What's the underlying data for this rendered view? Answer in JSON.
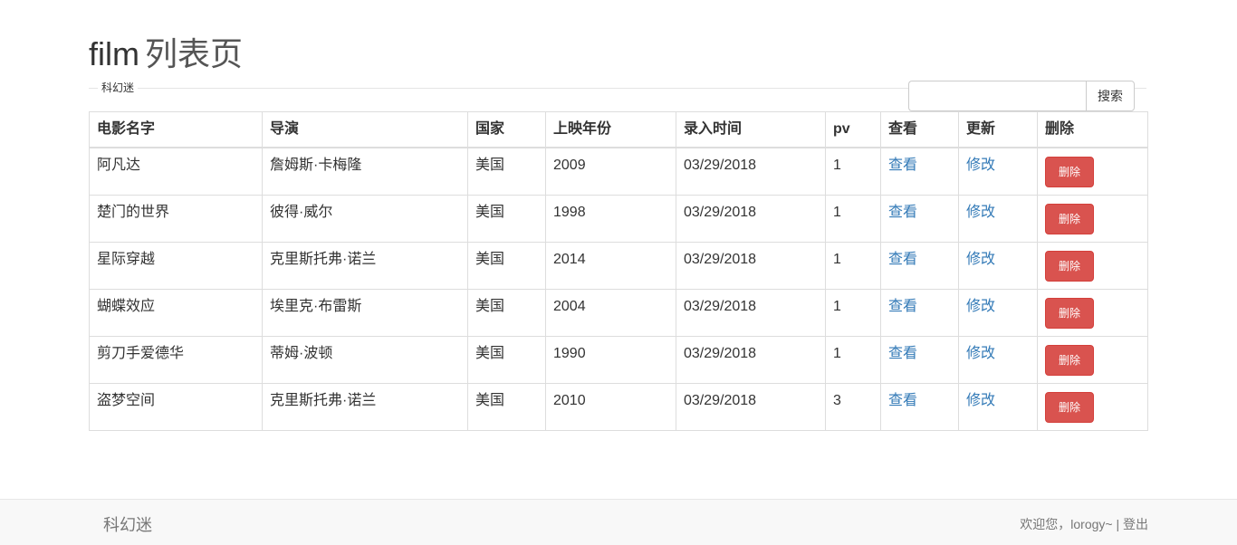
{
  "header": {
    "title_main": "film",
    "title_sub": "列表页"
  },
  "category": {
    "legend": "科幻迷"
  },
  "search": {
    "value": "",
    "placeholder": "",
    "button_label": "搜索"
  },
  "table": {
    "headers": [
      "电影名字",
      "导演",
      "国家",
      "上映年份",
      "录入时间",
      "pv",
      "查看",
      "更新",
      "删除"
    ],
    "rows": [
      {
        "name": "阿凡达",
        "director": "詹姆斯·卡梅隆",
        "country": "美国",
        "year": "2009",
        "created": "03/29/2018",
        "pv": "1",
        "view": "查看",
        "update": "修改",
        "delete": "删除"
      },
      {
        "name": "楚门的世界",
        "director": "彼得·威尔",
        "country": "美国",
        "year": "1998",
        "created": "03/29/2018",
        "pv": "1",
        "view": "查看",
        "update": "修改",
        "delete": "删除"
      },
      {
        "name": "星际穿越",
        "director": "克里斯托弗·诺兰",
        "country": "美国",
        "year": "2014",
        "created": "03/29/2018",
        "pv": "1",
        "view": "查看",
        "update": "修改",
        "delete": "删除"
      },
      {
        "name": "蝴蝶效应",
        "director": "埃里克·布雷斯",
        "country": "美国",
        "year": "2004",
        "created": "03/29/2018",
        "pv": "1",
        "view": "查看",
        "update": "修改",
        "delete": "删除"
      },
      {
        "name": "剪刀手爱德华",
        "director": "蒂姆·波顿",
        "country": "美国",
        "year": "1990",
        "created": "03/29/2018",
        "pv": "1",
        "view": "查看",
        "update": "修改",
        "delete": "删除"
      },
      {
        "name": "盗梦空间",
        "director": "克里斯托弗·诺兰",
        "country": "美国",
        "year": "2010",
        "created": "03/29/2018",
        "pv": "3",
        "view": "查看",
        "update": "修改",
        "delete": "删除"
      }
    ]
  },
  "footer": {
    "brand": "科幻迷",
    "welcome": "欢迎您，lorogy~",
    "separator": " | ",
    "logout": "登出"
  },
  "colors": {
    "link": "#337ab7",
    "danger": "#d9534f",
    "footer_bg": "#f8f8f8"
  }
}
